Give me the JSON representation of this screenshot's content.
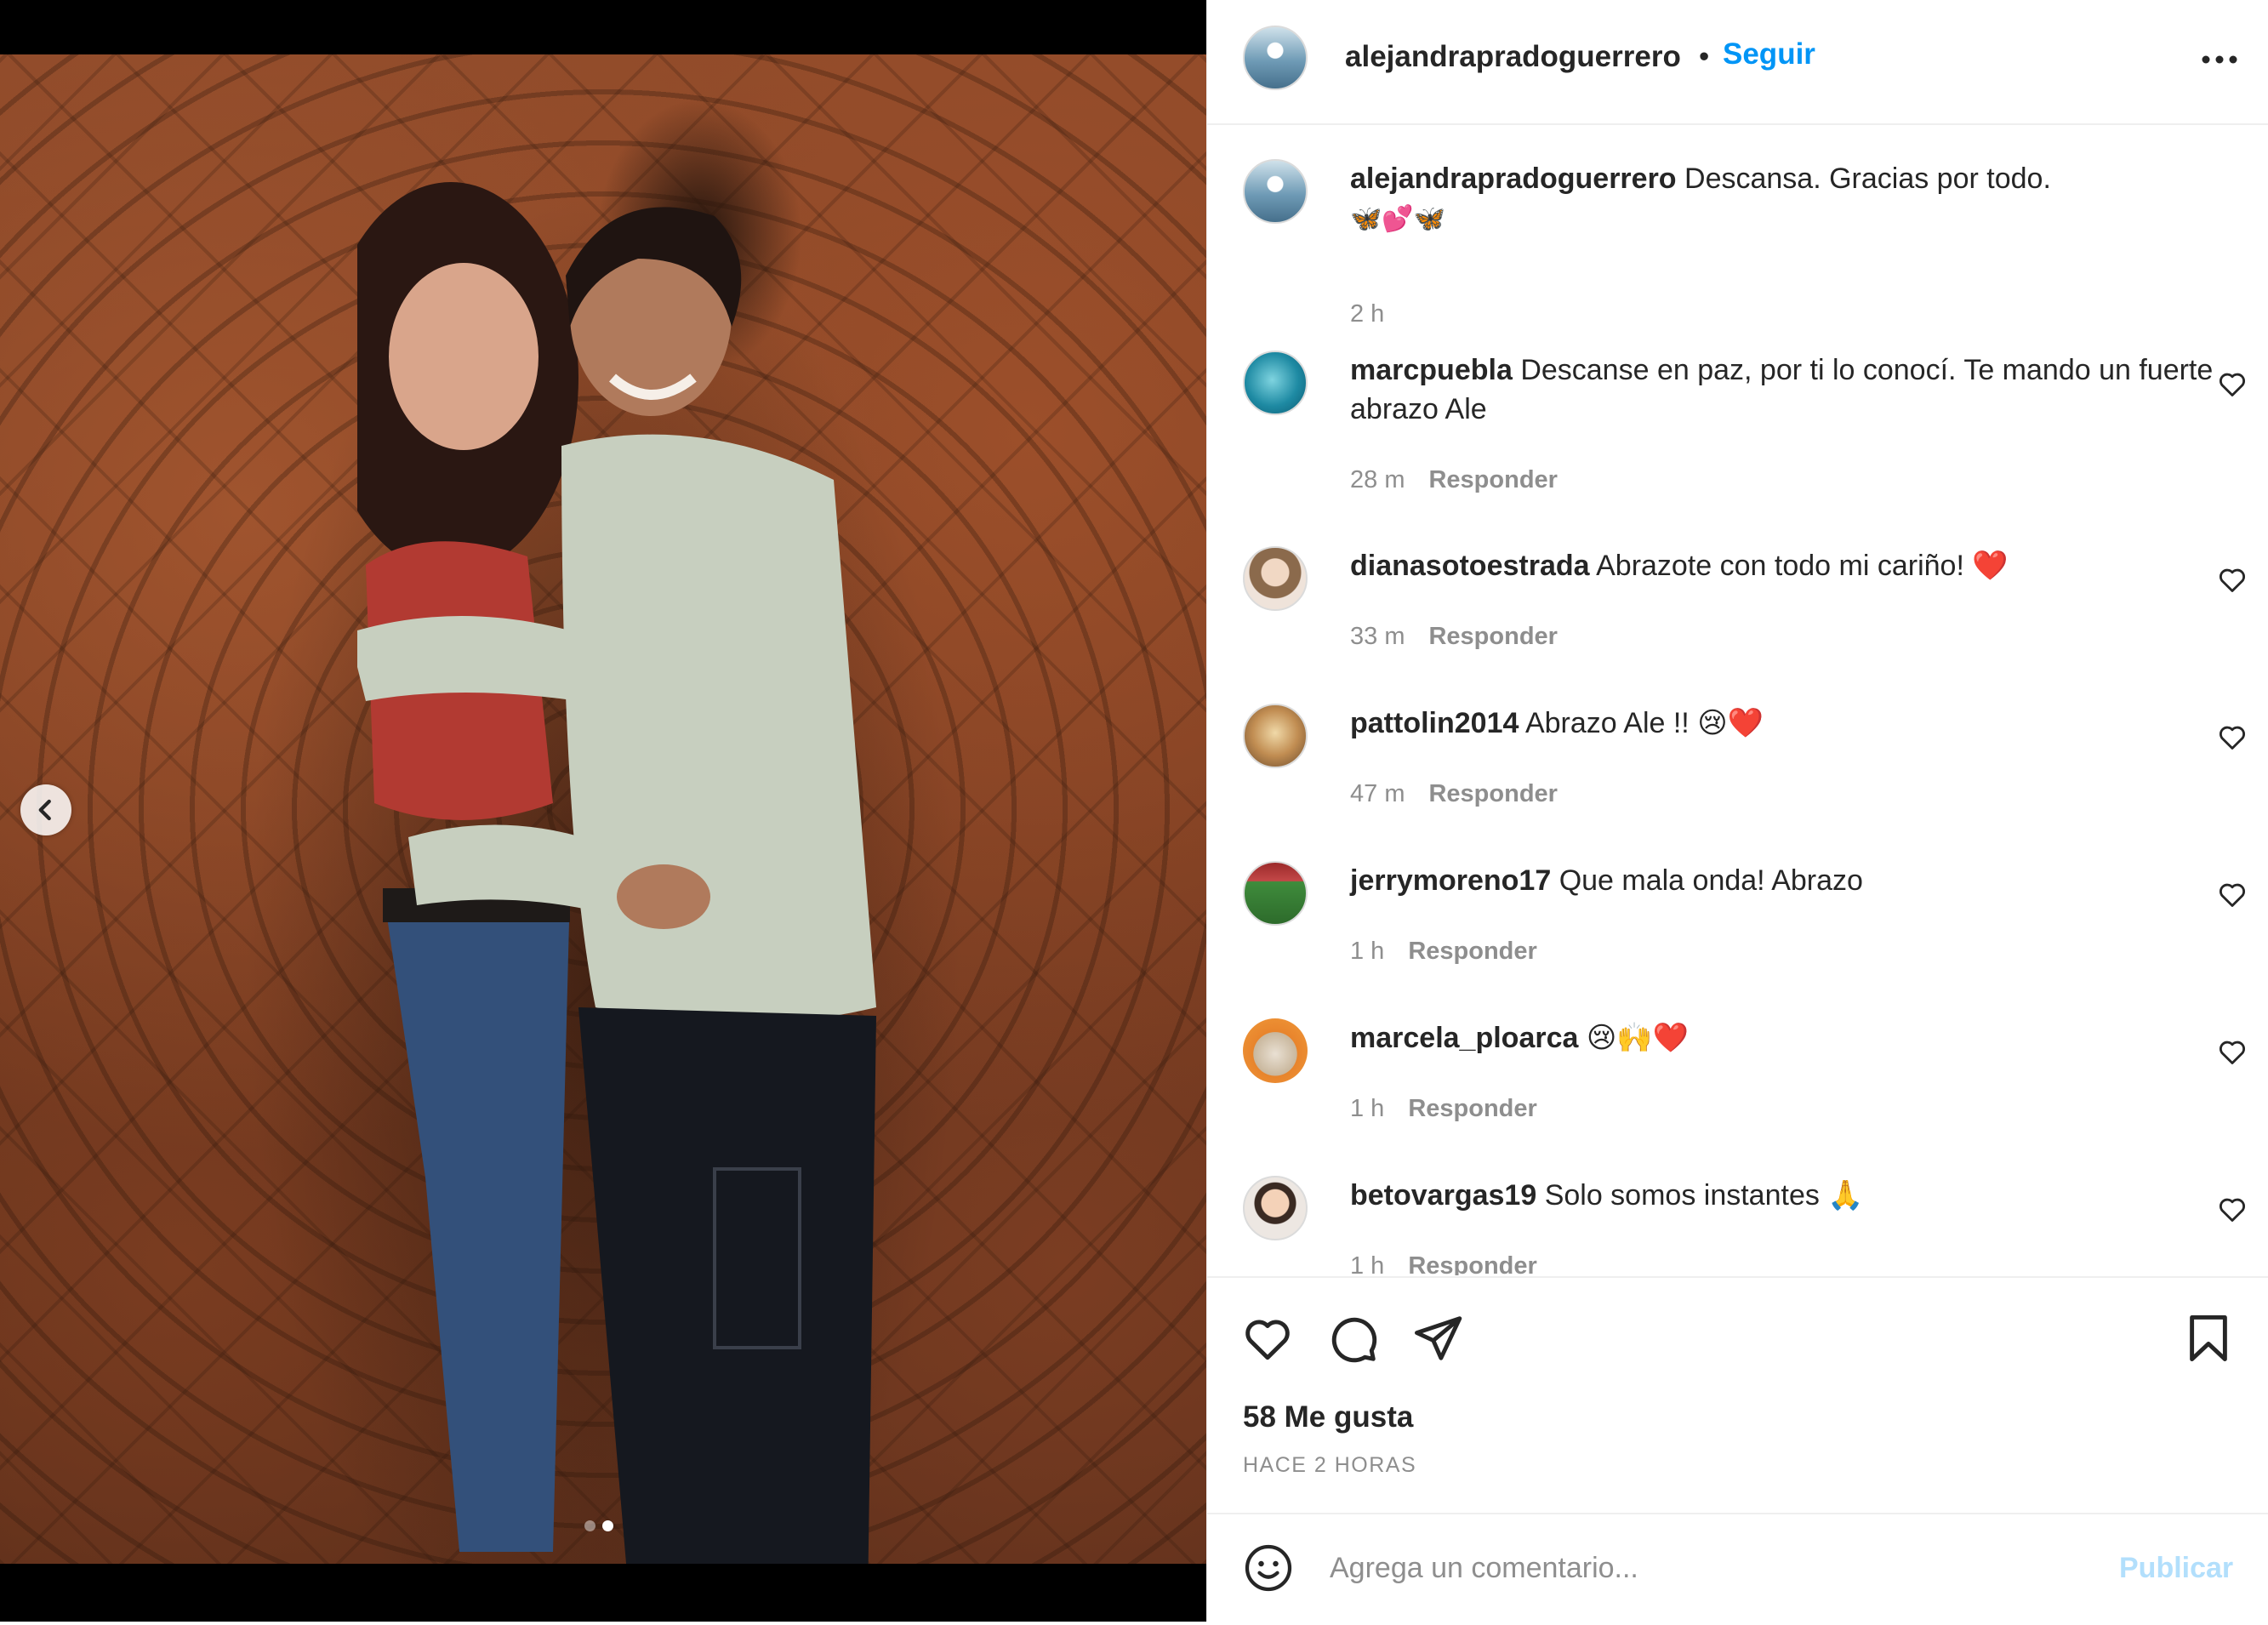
{
  "post": {
    "username": "alejandrapradoguerrero",
    "separator": "•",
    "follow_label": "Seguir",
    "caption": "Descansa. Gracias por todo.",
    "caption_emojis": "🦋💕🦋",
    "caption_time": "2 h"
  },
  "comments": [
    {
      "username": "marcpuebla",
      "text": "Descanse en paz, por ti lo conocí. Te mando un fuerte abrazo Ale",
      "time": "28 m",
      "reply": "Responder"
    },
    {
      "username": "dianasotoestrada",
      "text": "Abrazote con todo mi cariño! ❤️",
      "time": "33 m",
      "reply": "Responder"
    },
    {
      "username": "pattolin2014",
      "text": "Abrazo Ale !! 😢❤️",
      "time": "47 m",
      "reply": "Responder"
    },
    {
      "username": "jerrymoreno17",
      "text": "Que mala onda! Abrazo",
      "time": "1 h",
      "reply": "Responder"
    },
    {
      "username": "marcela_ploarca",
      "text": "😢🙌❤️",
      "time": "1 h",
      "reply": "Responder"
    },
    {
      "username": "betovargas19",
      "text": "Solo somos instantes 🙏",
      "time": "1 h",
      "reply": "Responder"
    }
  ],
  "footer": {
    "likes": "58 Me gusta",
    "posted": "HACE 2 HORAS",
    "comment_placeholder": "Agrega un comentario...",
    "publish_label": "Publicar"
  },
  "carousel": {
    "total": 2,
    "current": 2
  },
  "icons": [
    "chevron-left-icon",
    "more-icon",
    "heart-icon",
    "comment-icon",
    "share-icon",
    "bookmark-icon",
    "emoji-icon"
  ],
  "colors": {
    "link_blue": "#0095f6",
    "publish_disabled": "#b2dffc",
    "muted": "#8e8e8e",
    "text": "#262626"
  }
}
